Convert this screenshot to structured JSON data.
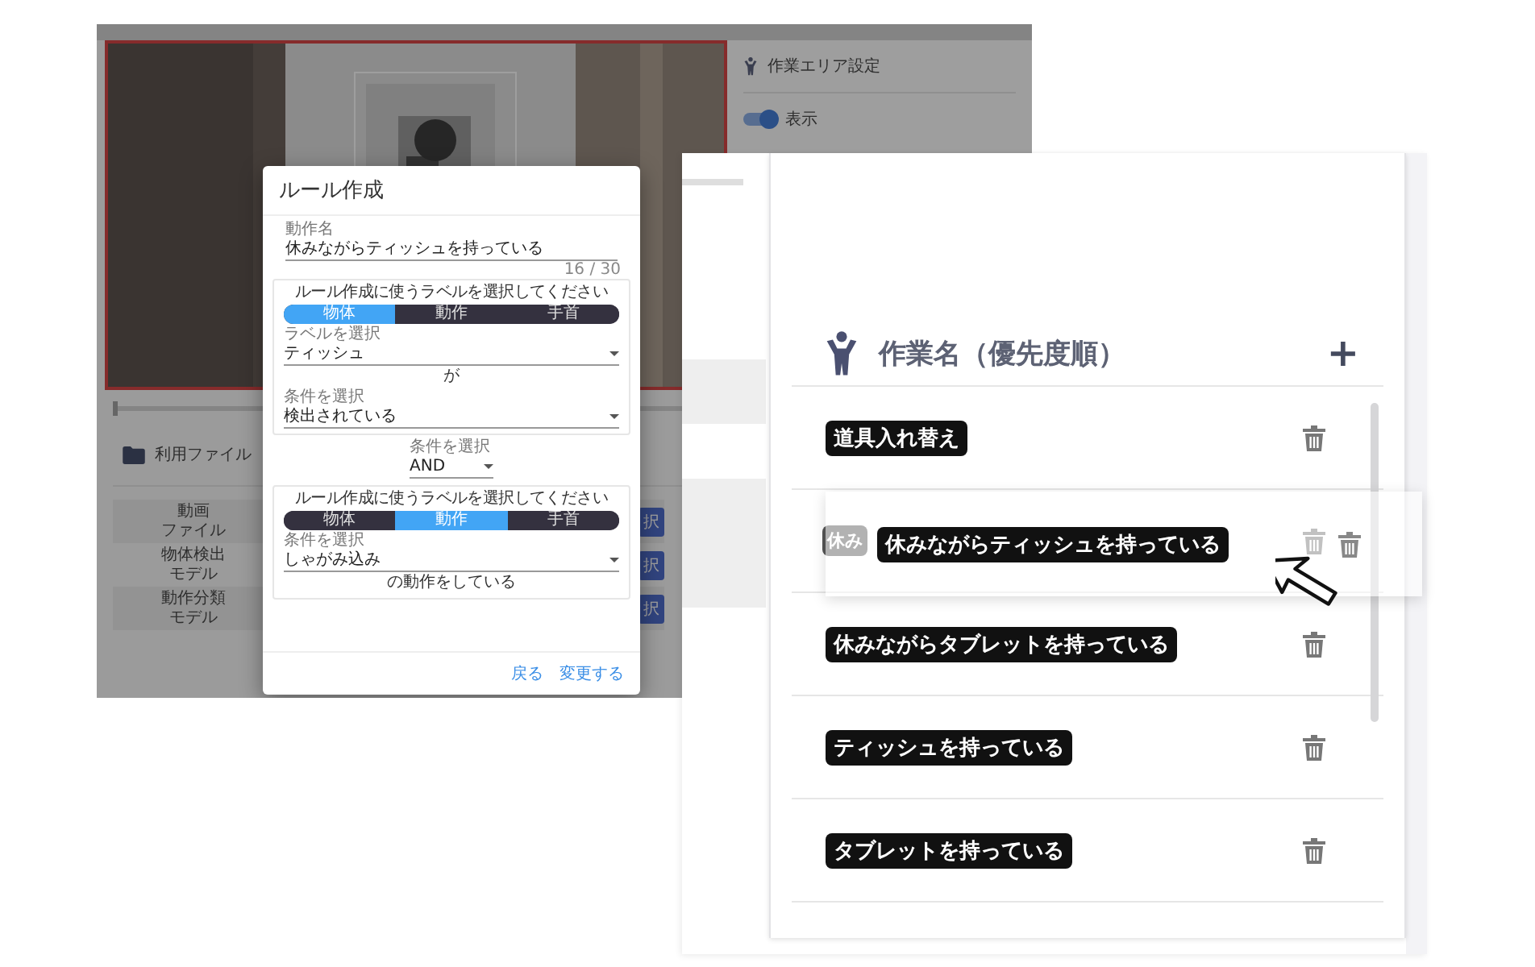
{
  "left_screen": {
    "settings_panel": {
      "title": "作業エリア設定",
      "display_toggle": {
        "label": "表示",
        "on": true
      }
    },
    "timeline": {
      "level": 0
    },
    "files": {
      "title": "利用ファイル",
      "rows": [
        {
          "label": [
            "動画",
            "ファイル"
          ],
          "button": "択"
        },
        {
          "label": [
            "物体検出",
            "モデル"
          ],
          "button": "択"
        },
        {
          "label": [
            "動作分類",
            "モデル"
          ],
          "button": "択"
        }
      ]
    },
    "dialog": {
      "title": "ルール作成",
      "name_field": {
        "label": "動作名",
        "value": "休みながらティッシュを持っている",
        "counter": "16 / 30"
      },
      "rules": [
        {
          "prompt": "ルール作成に使うラベルを選択してください",
          "segments": [
            {
              "label": "物体",
              "selected": true
            },
            {
              "label": "動作",
              "selected": false
            },
            {
              "label": "手首",
              "selected": false
            }
          ],
          "select": {
            "label": "ラベルを選択",
            "value": "ティッシュ"
          },
          "connector": "が",
          "condition": {
            "label": "条件を選択",
            "value": "検出されている"
          }
        },
        {
          "prompt": "ルール作成に使うラベルを選択してください",
          "segments": [
            {
              "label": "物体",
              "selected": false
            },
            {
              "label": "動作",
              "selected": true
            },
            {
              "label": "手首",
              "selected": false
            }
          ],
          "select": {
            "label": "条件を選択",
            "value": "しゃがみ込み"
          },
          "suffix": "の動作をしている"
        }
      ],
      "operator": {
        "label": "条件を選択",
        "value": "AND"
      },
      "actions": [
        "戻る",
        "変更する"
      ]
    }
  },
  "right_screen": {
    "title": "作業名（優先度順）",
    "add_button": "+",
    "tasks": [
      {
        "label": "道具入れ替え",
        "dragging": false
      },
      {
        "label": "休み",
        "dragging": true
      },
      {
        "label": "休みながらタブレットを持っている",
        "dragging": false
      },
      {
        "label": "ティッシュを持っている",
        "dragging": false
      },
      {
        "label": "タブレットを持っている",
        "dragging": false
      }
    ],
    "drag_preview": {
      "label": "休みながらティッシュを持っている"
    }
  }
}
